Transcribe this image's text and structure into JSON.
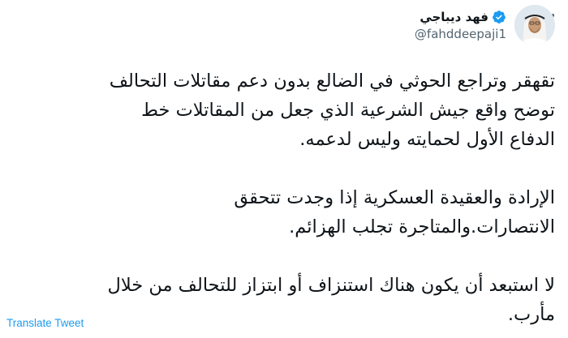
{
  "author": {
    "display_name": "فهد ديباجي",
    "handle": "@fahddeepaji1",
    "verified": true
  },
  "tweet": {
    "paragraphs": [
      [
        "تقهقر وتراجع الحوثي في الضالع بدون دعم مقاتلات التحالف",
        "توضح واقع جيش الشرعية الذي جعل من المقاتلات خط",
        "الدفاع الأول لحمايته وليس لدعمه."
      ],
      [
        "الإرادة والعقيدة العسكرية إذا وجدت تتحقق",
        "الانتصارات.والمتاجرة تجلب الهزائم."
      ],
      [
        "لا استبعد أن يكون هناك استنزاف أو ابتزاز للتحالف من خلال",
        "مأرب."
      ]
    ]
  },
  "actions": {
    "translate_label": "Translate Tweet"
  },
  "colors": {
    "verified_badge": "#1d9bf0",
    "link": "#1d9bf0",
    "secondary_text": "#536471"
  },
  "icons": [
    "more-options-icon",
    "verified-badge-icon"
  ]
}
